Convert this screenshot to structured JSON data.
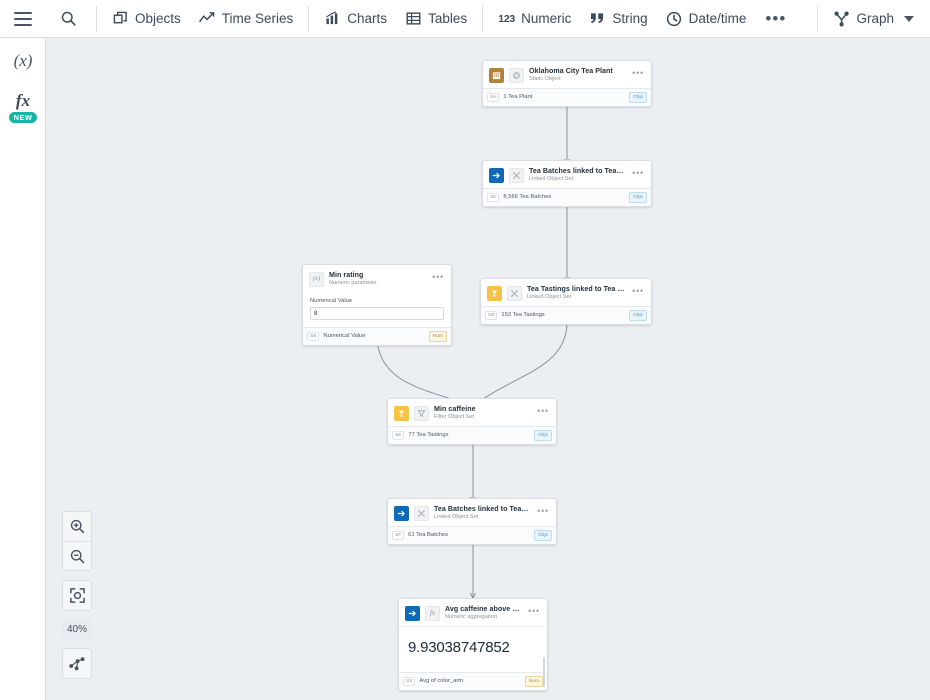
{
  "toolbar": {
    "menu_icon": "hamburger-icon",
    "search_icon": "search-icon",
    "items": [
      {
        "label": "Objects",
        "icon": "objects-icon"
      },
      {
        "label": "Time Series",
        "icon": "time-series-icon"
      },
      {
        "label": "Charts",
        "icon": "charts-icon"
      },
      {
        "label": "Tables",
        "icon": "tables-icon"
      },
      {
        "label": "Numeric",
        "icon": "numeric-123-icon"
      },
      {
        "label": "String",
        "icon": "quote-icon"
      },
      {
        "label": "Date/time",
        "icon": "clock-icon"
      }
    ],
    "overflow": "•••",
    "graph_label": "Graph"
  },
  "rail": {
    "variable_icon": "(x)",
    "function_icon": "fx",
    "new_badge": "NEW"
  },
  "zoom_controls": {
    "zoom_in": "zoom-in-icon",
    "zoom_out": "zoom-out-icon",
    "fit": "fit-to-screen-icon",
    "level": "40%",
    "layout": "auto-layout-icon"
  },
  "colors": {
    "canvas": "#eceff2",
    "node_border": "#dadee3",
    "brown": "#b2813f",
    "blue": "#1069b5",
    "gold": "#f5c245",
    "accent_new": "#18b5a6",
    "badge_objs": "#4a9fd4",
    "badge_num": "#c48a1e",
    "edge": "#8792a0"
  },
  "graph": {
    "nodes": [
      {
        "id": "oklahoma-city-tea-plant",
        "title": "Oklahoma City Tea Plant",
        "subtitle": "Static Object",
        "icon": "building-icon",
        "icon_color": "brown",
        "second_icon": "object-type-icon",
        "menu": "•••",
        "footer_chip": "SA",
        "footer_label": "1 Tea Plant",
        "footer_badge": "Objs",
        "badge_kind": "objs"
      },
      {
        "id": "tea-batches-linked-to-tea-plants",
        "title": "Tea Batches linked to Tea Plants",
        "subtitle": "Linked Object Set",
        "icon": "link-arrow-icon",
        "icon_color": "blue",
        "second_icon": "shuffle-icon",
        "menu": "•••",
        "footer_chip": "SE",
        "footer_label": "8,566 Tea Batches",
        "footer_badge": "Objs",
        "badge_kind": "objs"
      },
      {
        "id": "min-rating",
        "title": "Min rating",
        "subtitle": "Numeric parameter",
        "icon": "variable-x-icon",
        "icon_color": "grey",
        "menu": "•••",
        "field_label": "Numerical Value",
        "field_value": "8",
        "footer_chip": "SB",
        "footer_label": "Numerical Value",
        "footer_badge": "Num",
        "badge_kind": "num"
      },
      {
        "id": "tea-tastings-linked-to-tea-batches",
        "title": "Tea Tastings linked to Tea Batches",
        "subtitle": "Linked Object Set",
        "icon": "cup-icon",
        "icon_color": "gold",
        "second_icon": "shuffle-icon",
        "menu": "•••",
        "footer_chip": "SB",
        "footer_label": "153 Tea Tastings",
        "footer_badge": "Objs",
        "badge_kind": "objs"
      },
      {
        "id": "min-caffeine",
        "title": "Min caffeine",
        "subtitle": "Filter Object Set",
        "icon": "cup-icon",
        "icon_color": "gold",
        "second_icon": "filter-icon",
        "menu": "•••",
        "footer_chip": "SE",
        "footer_label": "77 Tea Tastings",
        "footer_badge": "Objs",
        "badge_kind": "objs"
      },
      {
        "id": "tea-batches-linked-to-tea-tastings",
        "title": "Tea Batches linked to Tea Tastings",
        "subtitle": "Linked Object Set",
        "icon": "link-arrow-icon",
        "icon_color": "blue",
        "second_icon": "shuffle-icon",
        "menu": "•••",
        "footer_chip": "SF",
        "footer_label": "61 Tea Batches",
        "footer_badge": "Objs",
        "badge_kind": "objs"
      },
      {
        "id": "avg-caffeine-above-rating",
        "title": "Avg caffeine above rating",
        "subtitle": "Numeric aggregation",
        "icon": "link-arrow-icon",
        "icon_color": "blue",
        "second_icon": "fx-icon",
        "menu": "•••",
        "result_value": "9.93038747852",
        "footer_chip": "SS",
        "footer_label": "Avg of color_arm",
        "footer_badge": "Num",
        "badge_kind": "num"
      }
    ]
  }
}
